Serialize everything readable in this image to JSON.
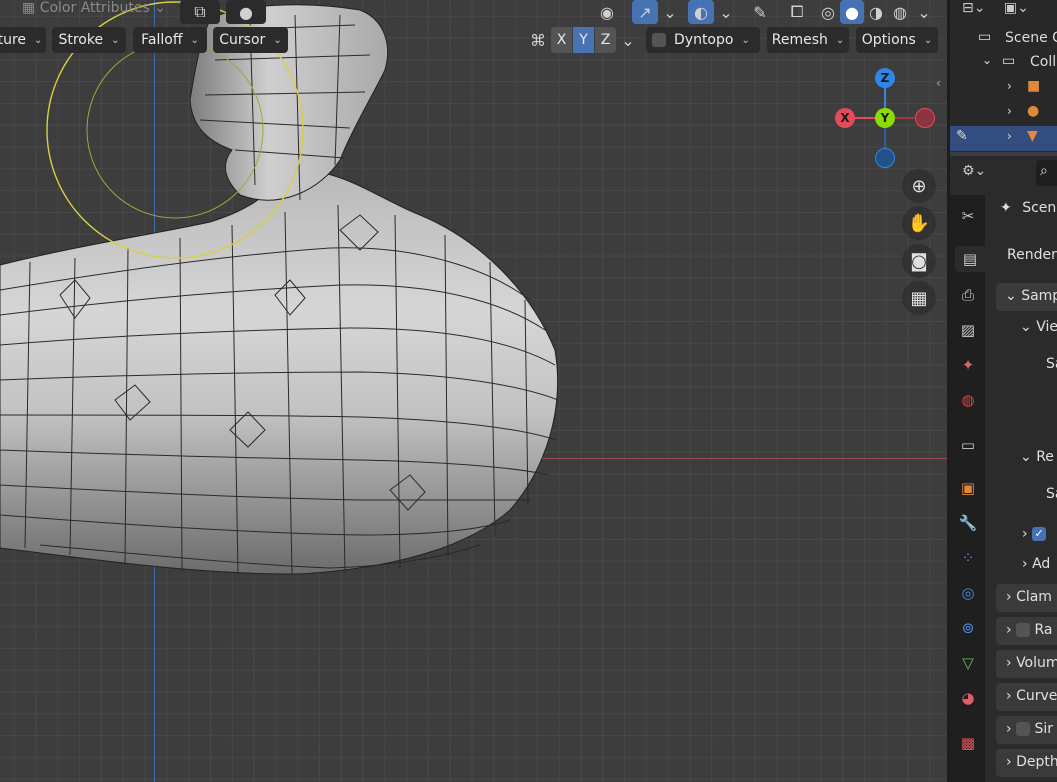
{
  "header": {
    "color_attributes_label": "Color Attributes",
    "chev": "⌄"
  },
  "tool_settings": {
    "texture_label": "ture",
    "stroke_label": "Stroke",
    "falloff_label": "Falloff",
    "cursor_label": "Cursor",
    "axis_x": "X",
    "axis_y": "Y",
    "axis_z": "Z",
    "dyntopo_label": "Dyntopo",
    "remesh_label": "Remesh",
    "options_label": "Options"
  },
  "gizmo": {
    "z": "Z",
    "y": "Y",
    "x": "X"
  },
  "colors": {
    "accent": "#4772b3",
    "x_axis": "#e34a5c",
    "y_axis": "#8bdc00",
    "z_axis": "#2f86e6",
    "brush_circle": "#d8d040"
  },
  "outliner": {
    "scene_label": "Scene C",
    "collection_label": "Coll"
  },
  "properties": {
    "scene_label": "Scen",
    "render_label": "Render",
    "sampling_label": "Samp",
    "viewport_label": "Vie",
    "samples_label_1": "Sa",
    "render_sub_label": "Re",
    "samples_label_2": "Sa",
    "advanced_label": "Ad",
    "clamping_label": "Clam",
    "raytracing_label": "Ra",
    "volumetrics_label": "Volum",
    "curves_label": "Curve",
    "simplify_label": "Sir",
    "depth_label": "Depth"
  }
}
